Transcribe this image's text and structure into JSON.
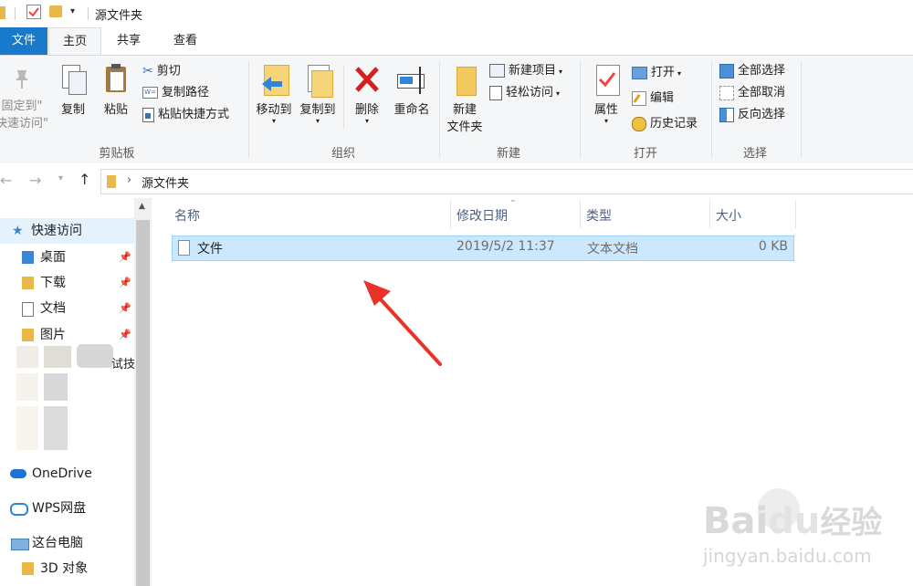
{
  "window": {
    "title": "源文件夹"
  },
  "tabs": {
    "file": "文件",
    "home": "主页",
    "share": "共享",
    "view": "查看"
  },
  "ribbon": {
    "clipboard": {
      "label": "剪贴板",
      "pin_line1": "固定到\"",
      "pin_line2": "快速访问\"",
      "copy": "复制",
      "paste": "粘贴",
      "cut": "剪切",
      "copy_path": "复制路径",
      "paste_shortcut": "粘贴快捷方式"
    },
    "organize": {
      "label": "组织",
      "move_to": "移动到",
      "copy_to": "复制到",
      "delete": "删除",
      "rename": "重命名"
    },
    "new": {
      "label": "新建",
      "new_folder_line1": "新建",
      "new_folder_line2": "文件夹",
      "new_item": "新建项目",
      "easy_access": "轻松访问"
    },
    "open": {
      "label": "打开",
      "properties": "属性",
      "open": "打开",
      "edit": "编辑",
      "history": "历史记录"
    },
    "select": {
      "label": "选择",
      "select_all": "全部选择",
      "select_none": "全部取消",
      "invert": "反向选择"
    }
  },
  "address": {
    "path": "源文件夹"
  },
  "nav": {
    "quick_access": "快速访问",
    "items": [
      {
        "label": "桌面"
      },
      {
        "label": "下载"
      },
      {
        "label": "文档"
      },
      {
        "label": "图片"
      }
    ],
    "partial": "试技",
    "onedrive": "OneDrive",
    "wps": "WPS网盘",
    "this_pc": "这台电脑",
    "objects3d": "3D 对象"
  },
  "columns": {
    "name": "名称",
    "modified": "修改日期",
    "type": "类型",
    "size": "大小"
  },
  "files": [
    {
      "name": "文件",
      "modified": "2019/5/2 11:37",
      "type": "文本文档",
      "size": "0 KB"
    }
  ],
  "watermark": {
    "brand_latin": "Bai",
    "brand_du": "du",
    "brand_cn": "经验",
    "url": "jingyan.baidu.com"
  },
  "colors": {
    "accent": "#1979ca",
    "selection": "#cce8ff",
    "arrow": "#e8332a"
  }
}
